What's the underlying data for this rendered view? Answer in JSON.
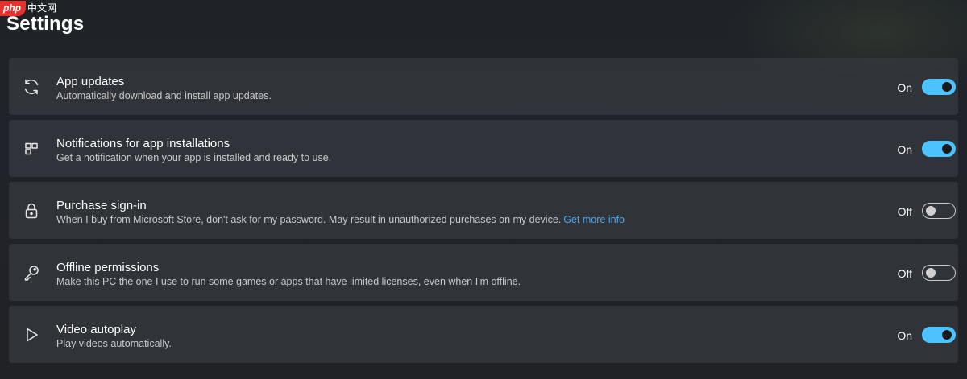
{
  "watermark": {
    "logo": "php",
    "site": "中文网"
  },
  "page": {
    "title": "Settings"
  },
  "colors": {
    "accent": "#4cc2ff",
    "link": "#4da8ee",
    "row_background": "#34383e",
    "page_background": "#202329"
  },
  "settings": [
    {
      "icon": "refresh-icon",
      "title": "App updates",
      "description": "Automatically download and install app updates.",
      "state_label": "On",
      "enabled": true
    },
    {
      "icon": "app-installations-icon",
      "title": "Notifications for app installations",
      "description": "Get a notification when your app is installed and ready to use.",
      "state_label": "On",
      "enabled": true
    },
    {
      "icon": "lock-icon",
      "title": "Purchase sign-in",
      "description": "When I buy from Microsoft Store, don't ask for my password. May result in unauthorized purchases on my device.",
      "link": "Get more info",
      "state_label": "Off",
      "enabled": false
    },
    {
      "icon": "key-icon",
      "title": "Offline permissions",
      "description": "Make this PC the one I use to run some games or apps that have limited licenses, even when I'm offline.",
      "state_label": "Off",
      "enabled": false
    },
    {
      "icon": "play-icon",
      "title": "Video autoplay",
      "description": "Play videos automatically.",
      "state_label": "On",
      "enabled": true
    }
  ]
}
